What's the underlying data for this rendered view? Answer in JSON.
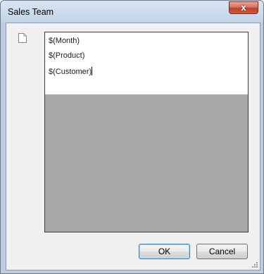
{
  "window": {
    "title": "Sales Team",
    "close_glyph": "x"
  },
  "editor": {
    "lines": [
      "$(Month)",
      "$(Product)",
      "$(Customer)"
    ]
  },
  "buttons": {
    "ok_label": "OK",
    "cancel_label": "Cancel"
  },
  "icons": {
    "document": "document-icon",
    "close": "close-icon",
    "grip": "resize-grip-icon"
  },
  "colors": {
    "editor_background": "#a9a9a9",
    "text_area": "#ffffff",
    "close_button": "#c0412c"
  }
}
